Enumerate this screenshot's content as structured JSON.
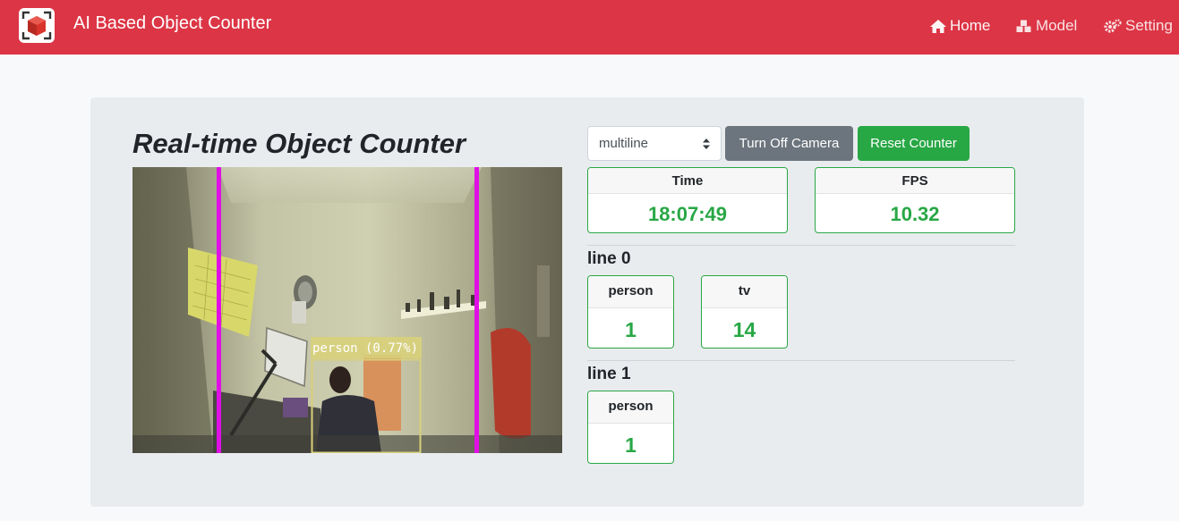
{
  "navbar": {
    "brand": "AI Based Object Counter",
    "items": [
      {
        "label": "Home",
        "icon": "home-icon"
      },
      {
        "label": "Model",
        "icon": "cubes-icon"
      },
      {
        "label": "Setting",
        "icon": "cogs-icon"
      }
    ]
  },
  "main": {
    "title": "Real-time Object Counter",
    "mode_select": {
      "value": "multiline"
    },
    "buttons": {
      "camera": "Turn Off Camera",
      "reset": "Reset Counter"
    },
    "stats": {
      "time": {
        "label": "Time",
        "value": "18:07:49"
      },
      "fps": {
        "label": "FPS",
        "value": "10.32"
      }
    },
    "lines": [
      {
        "label": "line 0",
        "counts": [
          {
            "name": "person",
            "value": "1"
          },
          {
            "name": "tv",
            "value": "14"
          }
        ]
      },
      {
        "label": "line 1",
        "counts": [
          {
            "name": "person",
            "value": "1"
          }
        ]
      }
    ],
    "feed": {
      "detection_label": "person (0.77%)"
    }
  },
  "colors": {
    "navbar": "#dc3545",
    "success": "#28a745",
    "secondary": "#6c757d",
    "count_line": "#e10ee6",
    "bbox": "#d8d07a"
  }
}
